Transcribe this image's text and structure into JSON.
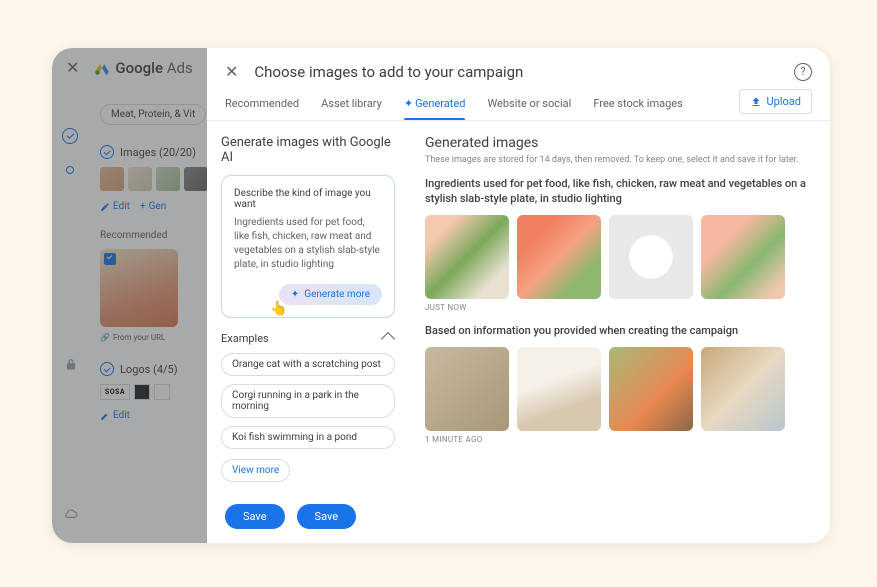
{
  "background": {
    "header": {
      "product": "Google",
      "suffix": "Ads"
    },
    "chip": "Meat, Protein, & Vit",
    "sections": {
      "images": {
        "title": "Images (20/20)",
        "edit": "Edit",
        "gen": "Gen"
      },
      "recommended_label": "Recommended",
      "from_url": "From your URL",
      "logos": {
        "title": "Logos (4/5)",
        "brand": "SOSA",
        "edit": "Edit"
      }
    }
  },
  "modal": {
    "title": "Choose images to add to your campaign",
    "tabs": [
      "Recommended",
      "Asset library",
      "Generated",
      "Website or social",
      "Free stock images"
    ],
    "active_tab_index": 2,
    "upload": "Upload"
  },
  "generate": {
    "title": "Generate images with Google AI",
    "describe_label": "Describe the kind of image you want",
    "prompt_text": "Ingredients used for pet food, like fish, chicken, raw meat and vegetables on a stylish slab-style plate, in studio lighting",
    "button": "Generate more",
    "examples_title": "Examples",
    "examples": [
      "Orange cat with a scratching post",
      "Corgi running in a park in the morning",
      "Koi fish swimming in a pond"
    ],
    "view_more": "View more"
  },
  "results": {
    "title": "Generated images",
    "retention_note": "These images are stored for 14 days, then removed. To keep one, select it and save it for later.",
    "group1": {
      "prompt": "Ingredients used for pet food, like fish, chicken, raw meat and vegetables on a stylish slab-style plate, in studio lighting",
      "time": "JUST NOW"
    },
    "group2": {
      "prompt": "Based on information you provided when creating the campaign",
      "time": "1 MINUTE AGO"
    }
  },
  "footer": {
    "save1": "Save",
    "save2": "Save"
  }
}
